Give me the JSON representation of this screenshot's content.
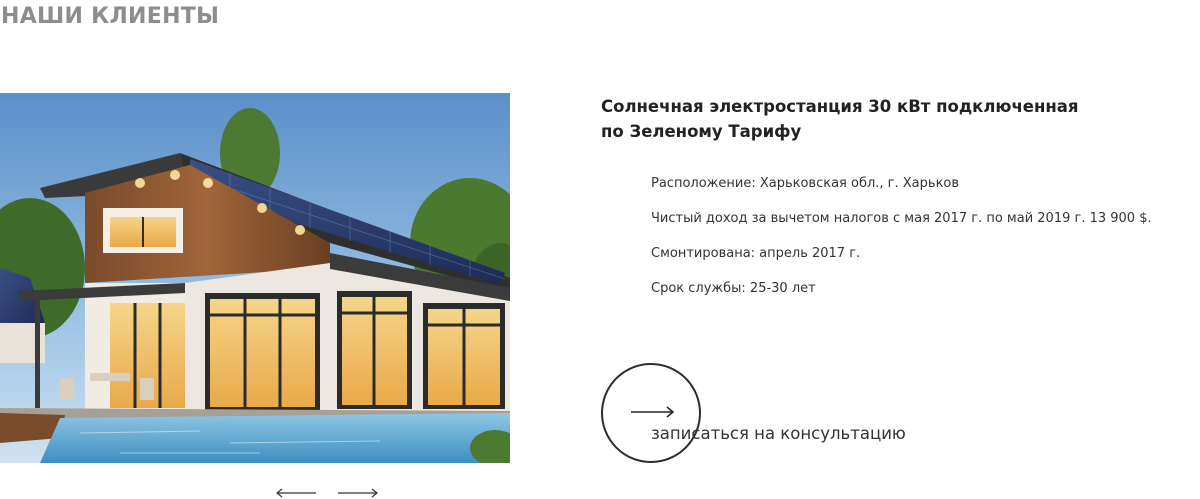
{
  "section": {
    "title": "НАШИ КЛИЕНТЫ"
  },
  "project": {
    "title_line1": "Солнечная электростанция 30 кВт подключенная",
    "title_line2": "по Зеленому Тарифу",
    "details": [
      "Расположение: Харьковская обл., г. Харьков",
      "Чистый доход за вычетом налогов с мая 2017 г. по май 2019 г. 13 900 $.",
      "Смонтирована: апрель 2017 г.",
      "Срок службы: 25-30 лет"
    ]
  },
  "cta": {
    "label": "записаться на консультацию",
    "icon": "arrow-right-icon"
  },
  "carousel": {
    "prev_icon": "arrow-left-icon",
    "next_icon": "arrow-right-icon"
  },
  "colors": {
    "title_gray": "#8d8d8d",
    "text_dark": "#222222",
    "line": "#2c2c2c"
  }
}
